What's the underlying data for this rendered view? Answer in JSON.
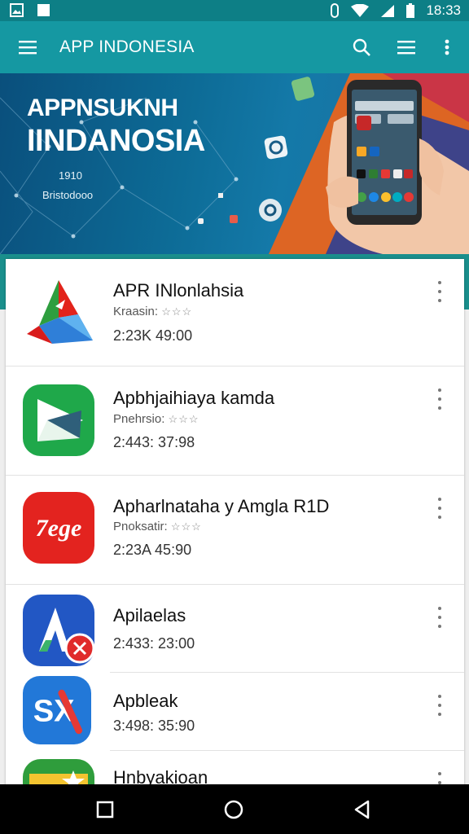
{
  "status_bar": {
    "time": "18:33",
    "left_icons": [
      "image-icon",
      "notification-square-icon"
    ],
    "right_icons": [
      "vibrate-icon",
      "wifi-icon",
      "signal-icon",
      "battery-icon"
    ]
  },
  "app_bar": {
    "title": "APP INDONESIA",
    "menu_icon": "hamburger-menu-icon",
    "actions": [
      "search-icon",
      "list-icon",
      "more-vertical-icon"
    ]
  },
  "banner": {
    "title_line1": "APPNSUKNH",
    "title_line2": "IINDANOSIA",
    "small_line1": "1910",
    "small_line2": "Bristodooo"
  },
  "apps": [
    {
      "name": "APR INlonlahsia",
      "meta": "Kraasin:",
      "stars": "☆☆☆",
      "size": "2:23K  49:00",
      "icon": "triangle-logo-icon"
    },
    {
      "name": "Apbhjaihiaya kamda",
      "meta": "Pnehrsio:",
      "stars": "☆☆☆",
      "size": "2:443:  37:98",
      "icon": "green-play-icon"
    },
    {
      "name": "Apharlnataha y Amgla R1D",
      "meta": "Pnoksatir:",
      "stars": "☆☆☆",
      "size": "2:23A  45:90",
      "icon": "red-7ege-logo-icon"
    },
    {
      "name": "Apilaelas",
      "meta": "",
      "stars": "",
      "size": "2:433:  23:00",
      "icon": "blue-a-logo-icon"
    },
    {
      "name": "Apbleak",
      "meta": "",
      "stars": "",
      "size": "3:498:  35:90",
      "icon": "sx-logo-icon"
    },
    {
      "name": "Hnbyakioan",
      "meta": "",
      "stars": "",
      "size": "",
      "icon": "green-star-logo-icon"
    }
  ],
  "nav_bar": [
    "recent-apps-icon",
    "home-icon",
    "back-icon"
  ],
  "colors": {
    "status_bar": "#0d7f86",
    "app_bar": "#1598a2",
    "banner": "#0d6c97",
    "accent_teal": "#1a8f8c"
  }
}
